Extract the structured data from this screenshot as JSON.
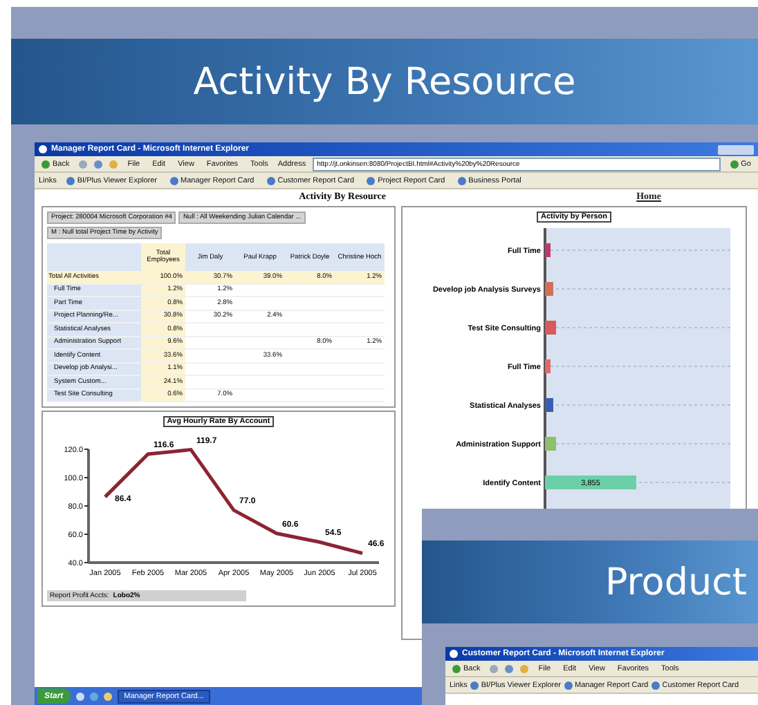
{
  "slide": {
    "title": "Activity By Resource"
  },
  "browser": {
    "title": "Manager Report Card - Microsoft Internet Explorer",
    "back": "Back",
    "menus": [
      "File",
      "Edit",
      "View",
      "Favorites",
      "Tools"
    ],
    "address_label": "Address",
    "address": "http://jt.onkinsen:8080/ProjectBI.html#Activity%20by%20Resource",
    "go": "Go",
    "links_label": "Links",
    "links": [
      "BI/Plus Viewer Explorer",
      "Manager Report Card",
      "Customer Report Card",
      "Project Report Card",
      "Business Portal"
    ]
  },
  "page": {
    "title": "Activity By Resource",
    "home_link": "Home"
  },
  "pivot": {
    "filters": [
      "Project: 280004 Microsoft Corporation #4",
      "Null : All Weekending Julian Calendar ...",
      "M : Null total Project Time by Activity"
    ],
    "columns": [
      "Total Employees",
      "Jim Daly",
      "Paul Krapp",
      "Patrick Doyle",
      "Christine Hoch"
    ],
    "rows": [
      {
        "label": "Total All Activities",
        "total": true,
        "cells": [
          "100.0%",
          "30.7%",
          "39.0%",
          "8.0%",
          "1.2%"
        ]
      },
      {
        "label": "Full Time",
        "total": false,
        "cells": [
          "1.2%",
          "1.2%",
          "",
          "",
          ""
        ]
      },
      {
        "label": "Part Time",
        "total": false,
        "cells": [
          "0.8%",
          "2.8%",
          "",
          "",
          ""
        ]
      },
      {
        "label": "Project Planning/Re...",
        "total": false,
        "cells": [
          "30.8%",
          "30.2%",
          "2.4%",
          "",
          ""
        ]
      },
      {
        "label": "Statistical Analyses",
        "total": false,
        "cells": [
          "0.8%",
          "",
          "",
          "",
          ""
        ]
      },
      {
        "label": "Administration Support",
        "total": false,
        "cells": [
          "9.6%",
          "",
          "",
          "8.0%",
          "1.2%"
        ]
      },
      {
        "label": "Identify Content",
        "total": false,
        "cells": [
          "33.6%",
          "",
          "33.6%",
          "",
          ""
        ]
      },
      {
        "label": "Develop job Analysi...",
        "total": false,
        "cells": [
          "1.1%",
          "",
          "",
          "",
          ""
        ]
      },
      {
        "label": "System Custom...",
        "total": false,
        "cells": [
          "24.1%",
          "",
          "",
          "",
          ""
        ]
      },
      {
        "label": "Test Site Consulting",
        "total": false,
        "cells": [
          "0.6%",
          "7.0%",
          "",
          "",
          ""
        ]
      }
    ]
  },
  "line_chart": {
    "chart_data": {
      "type": "line",
      "title": "Avg Hourly Rate By Account",
      "categories": [
        "Jan 2005",
        "Feb 2005",
        "Mar 2005",
        "Apr 2005",
        "May 2005",
        "Jun 2005",
        "Jul 2005"
      ],
      "series": [
        {
          "color": "#8b2433",
          "values": [
            86.4,
            116.6,
            119.7,
            77.0,
            60.6,
            54.5,
            46.6
          ]
        }
      ],
      "ylim": [
        40,
        120
      ],
      "yticks": [
        {
          "value": 40,
          "label": "40.0"
        },
        {
          "value": 60,
          "label": "60.0"
        },
        {
          "value": 80,
          "label": "80.0"
        },
        {
          "value": 100,
          "label": "100.0"
        },
        {
          "value": 120,
          "label": "120.0"
        }
      ],
      "value_labels": [
        "86.4",
        "116.6",
        "119.7",
        "77.0",
        "60.6",
        "54.5",
        "46.6"
      ]
    },
    "footer_label": "Report Profit Accts:",
    "footer_value": "Lobo2%"
  },
  "bar_chart": {
    "title": "Activity by Person",
    "bars": [
      {
        "label": "Full Time",
        "color": "#c0396b"
      },
      {
        "label": "Develop job Analysis Surveys",
        "color": "#d0705a"
      },
      {
        "label": "Test Site Consulting",
        "color": "#d85a5a"
      },
      {
        "label": "Full Time",
        "color": "#e06a6a"
      },
      {
        "label": "Statistical Analyses",
        "color": "#3a5fb0"
      },
      {
        "label": "Administration Support",
        "color": "#8cc06a"
      },
      {
        "label": "Identify Content",
        "color": "#6ccfa8",
        "value_label": "3,855"
      }
    ]
  },
  "taskbar": {
    "start": "Start",
    "tasks": [
      "Manager Report Card..."
    ]
  },
  "next_slide": {
    "title": "Product",
    "browser": {
      "title": "Customer Report Card - Microsoft Internet Explorer",
      "back": "Back",
      "menus": [
        "File",
        "Edit",
        "View",
        "Favorites",
        "Tools"
      ],
      "links_label": "Links",
      "links": [
        "BI/Plus Viewer Explorer",
        "Manager Report Card",
        "Customer Report Card"
      ]
    }
  }
}
